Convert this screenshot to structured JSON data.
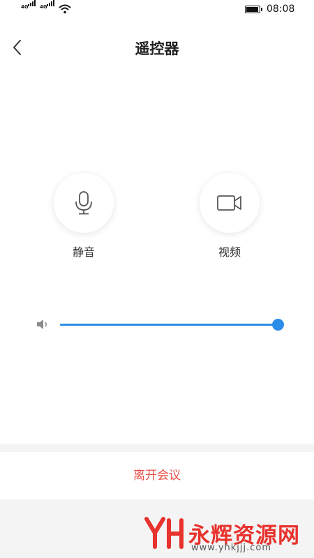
{
  "status_bar": {
    "network_1": "4G",
    "network_2": "4G",
    "time": "08:08",
    "battery_level": 0.95,
    "icons": [
      "signal-icon",
      "signal-icon",
      "wifi-icon",
      "battery-icon"
    ]
  },
  "header": {
    "back_icon": "chevron-left-icon",
    "title": "遥控器"
  },
  "controls": [
    {
      "label": "静音",
      "icon": "microphone-icon"
    },
    {
      "label": "视频",
      "icon": "video-camera-icon"
    }
  ],
  "volume": {
    "icon": "speaker-icon",
    "level": 1.0,
    "accent_color": "#2a8de8"
  },
  "actions": {
    "leave_label": "离开会议",
    "leave_color": "#e84c45"
  },
  "watermark": {
    "name": "永辉资源网",
    "url": "www.yhkjjj.com"
  }
}
